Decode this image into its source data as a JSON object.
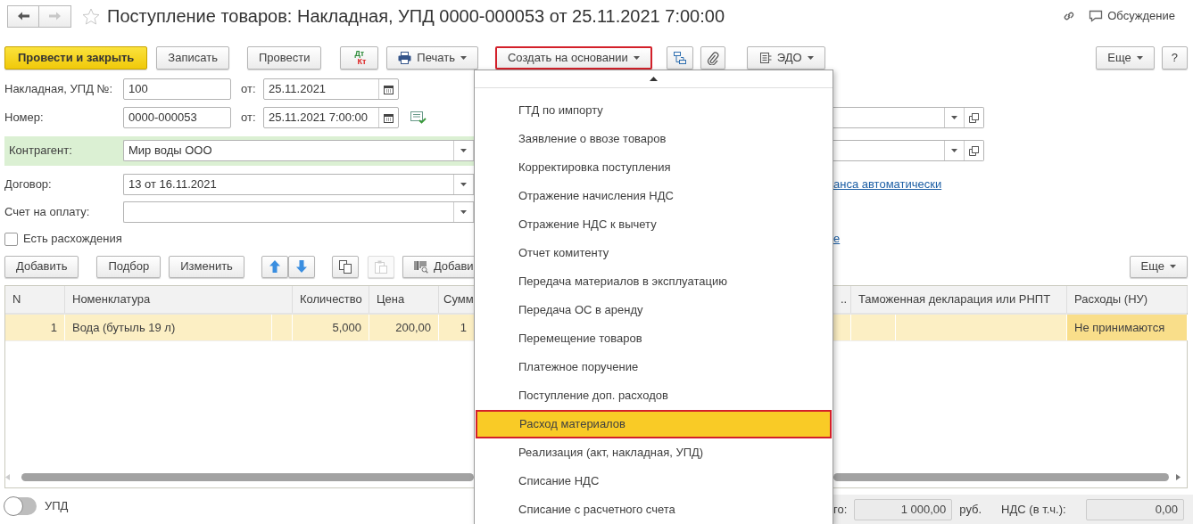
{
  "window": {
    "title": "Поступление товаров: Накладная, УПД 0000-000053 от 25.11.2021 7:00:00",
    "favorite": false
  },
  "nav": [
    {
      "kind": "back",
      "disabled": false
    },
    {
      "kind": "forward",
      "disabled": true
    }
  ],
  "header_links": [
    {
      "kind": "link"
    },
    {
      "kind": "discussion",
      "label": "Обсуждение"
    }
  ],
  "toolbar": [
    {
      "kind": "button",
      "label": "Провести и закрыть",
      "default": true
    },
    {
      "kind": "button",
      "label": "Записать",
      "default": false
    },
    {
      "kind": "button",
      "label": "Провести",
      "default": false
    },
    {
      "kind": "dtkt",
      "top": "Дт",
      "bottom": "Кт"
    },
    {
      "kind": "print",
      "label": "Печать"
    },
    {
      "kind": "menu",
      "label": "Создать на основании",
      "highlighted": true
    },
    {
      "kind": "structure"
    },
    {
      "kind": "clip"
    },
    {
      "kind": "edo",
      "label": "ЭДО"
    }
  ],
  "toolbar_right": [
    {
      "kind": "menu",
      "label": "Еще"
    },
    {
      "kind": "button",
      "label": "?"
    }
  ],
  "form": [
    {
      "kind": "number_date",
      "label": "Накладная, УПД №:",
      "value": "100",
      "date_label": "от:",
      "date": "25.11.2021",
      "posted": false
    },
    {
      "kind": "number_date",
      "label": "Номер:",
      "value": "0000-000053",
      "date_label": "от:",
      "date": "25.11.2021  7:00:00",
      "posted": true,
      "right": {
        "kind": "select_open"
      }
    },
    {
      "kind": "select",
      "label": "Контрагент:",
      "value": "Мир воды ООО",
      "highlighted": true,
      "right": {
        "kind": "select_open"
      }
    },
    {
      "kind": "select",
      "label": "Договор:",
      "value": "13 от 16.11.2021",
      "highlighted": false,
      "right": {
        "kind": "link",
        "label": "анса автоматически"
      }
    },
    {
      "kind": "select",
      "label": "Счет на оплату:",
      "highlighted": false
    },
    {
      "kind": "checkbox",
      "label": "Есть расхождения",
      "checked": false,
      "right": {
        "kind": "link",
        "label": "е"
      }
    }
  ],
  "table_toolbar": [
    {
      "kind": "button",
      "label": "Добавить"
    },
    {
      "kind": "button",
      "label": "Подбор"
    },
    {
      "kind": "button",
      "label": "Изменить"
    },
    {
      "kind": "up"
    },
    {
      "kind": "down"
    },
    {
      "kind": "copy",
      "disabled": false
    },
    {
      "kind": "paste",
      "disabled": true
    },
    {
      "kind": "barcode",
      "label": "Добави"
    }
  ],
  "table_toolbar_right": [
    {
      "kind": "menu",
      "label": "Еще"
    }
  ],
  "table": {
    "columns": [
      {
        "label": "N"
      },
      {
        "label": "Номенклатура"
      },
      {
        "label": "Количество"
      },
      {
        "label": "Цена"
      },
      {
        "label": "Сумм"
      },
      {
        "label": ".."
      },
      {
        "label": "Таможенная декларация или РНПТ"
      },
      {
        "label": "Расходы (НУ)"
      }
    ],
    "rows": [
      {
        "selected": true,
        "cells": [
          {
            "text": "1"
          },
          {
            "text": "Вода (бутыль 19 л)"
          },
          {
            "text": "5,000"
          },
          {
            "text": "200,00"
          },
          {
            "text": "1"
          },
          {},
          {},
          {
            "text": "Не принимаются",
            "current": true
          }
        ]
      }
    ]
  },
  "switch": {
    "label": "УПД",
    "on": false
  },
  "totals": [
    {
      "label": "го:",
      "value": "1 000,00",
      "unit": "руб."
    },
    {
      "label": "НДС (в т.ч.):",
      "value": "0,00"
    }
  ],
  "popup_menu": {
    "items": [
      {
        "label": "ГТД по импорту",
        "selected": false
      },
      {
        "label": "Заявление о ввозе товаров",
        "selected": false
      },
      {
        "label": "Корректировка поступления",
        "selected": false
      },
      {
        "label": "Отражение начисления НДС",
        "selected": false
      },
      {
        "label": "Отражение НДС к вычету",
        "selected": false
      },
      {
        "label": "Отчет комитенту",
        "selected": false
      },
      {
        "label": "Передача материалов в эксплуатацию",
        "selected": false
      },
      {
        "label": "Передача ОС в аренду",
        "selected": false
      },
      {
        "label": "Перемещение товаров",
        "selected": false
      },
      {
        "label": "Платежное поручение",
        "selected": false
      },
      {
        "label": "Поступление доп. расходов",
        "selected": false
      },
      {
        "label": "Расход материалов",
        "selected": true
      },
      {
        "label": "Реализация (акт, накладная, УПД)",
        "selected": false
      },
      {
        "label": "Списание НДС",
        "selected": false
      },
      {
        "label": "Списание с расчетного счета",
        "selected": false
      }
    ]
  }
}
